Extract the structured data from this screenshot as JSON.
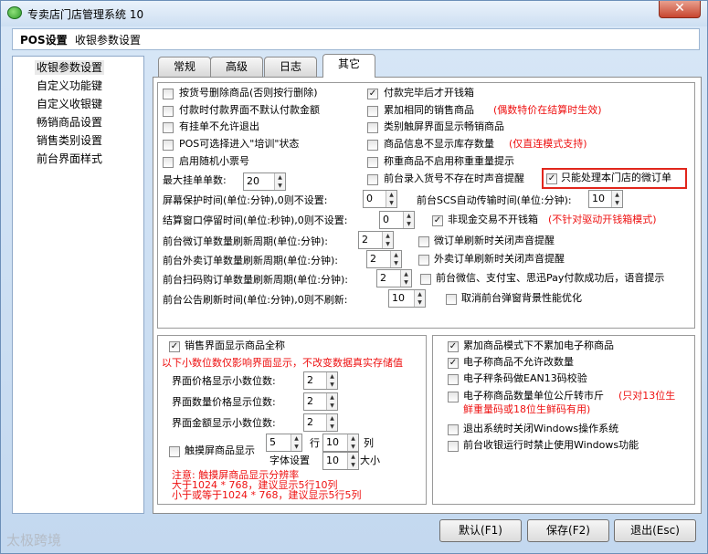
{
  "window": {
    "title": "专卖店门店管理系统 10",
    "close_label": "✕"
  },
  "menubar": {
    "items": [
      "POS设置",
      "收银参数设置"
    ]
  },
  "sidebar": {
    "items": [
      "收银参数设置",
      "自定义功能键",
      "自定义收银键",
      "畅销商品设置",
      "销售类别设置",
      "前台界面样式"
    ],
    "selected": 0
  },
  "tabs": [
    {
      "label": "常规"
    },
    {
      "label": "高级"
    },
    {
      "label": "日志"
    },
    {
      "label": "其它",
      "active": true
    }
  ],
  "top_options": {
    "left": [
      {
        "label": "按货号删除商品(否则按行删除)",
        "checked": false
      },
      {
        "label": "付款时付款界面不默认付款金额",
        "checked": false
      },
      {
        "label": "有挂单不允许退出",
        "checked": false
      },
      {
        "label": "POS可选择进入\"培训\"状态",
        "checked": false
      },
      {
        "label": "启用随机小票号",
        "checked": false
      }
    ],
    "right": [
      {
        "label": "付款完毕后才开钱箱",
        "checked": true
      },
      {
        "label": "累加相同的销售商品",
        "note": "(偶数特价在结算时生效)",
        "checked": false
      },
      {
        "label": "类别触屏界面显示畅销商品",
        "checked": false
      },
      {
        "label": "商品信息不显示库存数量",
        "note": "(仅直连模式支持)",
        "checked": false
      },
      {
        "label": "称重商品不启用称重重量提示",
        "checked": false
      },
      {
        "label": "前台录入货号不存在时声音提醒",
        "checked": false
      }
    ],
    "highlight": {
      "label": "只能处理本门店的微订单",
      "checked": true
    }
  },
  "fields": {
    "max_hold": {
      "label": "最大挂单单数:",
      "value": "20"
    },
    "screen_protect": {
      "label": "屏幕保护时间(单位:分钟),0则不设置:",
      "value": "0"
    },
    "scs_auto": {
      "label": "前台SCS自动传输时间(单位:分钟):",
      "value": "10"
    },
    "settle_stay": {
      "label": "结算窗口停留时间(单位:秒钟),0则不设置:",
      "value": "0"
    },
    "noncash": {
      "label": "非现金交易不开钱箱",
      "note": "(不针对驱动开钱箱模式)",
      "checked": true
    },
    "micro_refresh": {
      "label": "前台微订单数量刷新周期(单位:分钟):",
      "value": "2"
    },
    "micro_sound": {
      "label": "微订单刷新时关闭声音提醒",
      "checked": false
    },
    "takeout_refresh": {
      "label": "前台外卖订单数量刷新周期(单位:分钟):",
      "value": "2"
    },
    "takeout_sound": {
      "label": "外卖订单刷新时关闭声音提醒",
      "checked": false
    },
    "scan_refresh": {
      "label": "前台扫码购订单数量刷新周期(单位:分钟):",
      "value": "2"
    },
    "pay_voice": {
      "label": "前台微信、支付宝、思迅Pay付款成功后，语音提示",
      "checked": false
    },
    "notice_refresh": {
      "label": "前台公告刷新时间(单位:分钟),0则不刷新:",
      "value": "10"
    },
    "popup_opt": {
      "label": "取消前台弹窗背景性能优化",
      "checked": false
    }
  },
  "bottom_left": {
    "show_full": {
      "label": "销售界面显示商品全称",
      "checked": true
    },
    "note": "以下小数位数仅影响界面显示，不改变数据真实存储值",
    "price_dec": {
      "label": "界面价格显示小数位数:",
      "value": "2"
    },
    "qty_dec": {
      "label": "界面数量价格显示位数:",
      "value": "2"
    },
    "amt_dec": {
      "label": "界面金额显示小数位数:",
      "value": "2"
    },
    "touch": {
      "label": "触摸屏商品显示",
      "checked": false,
      "rows": "5",
      "rows_unit": "行",
      "cols": "10",
      "cols_unit": "列",
      "font_label": "字体设置",
      "font": "10",
      "font_unit": "大小"
    },
    "warn": [
      "注意: 触摸屏商品显示分辨率",
      "大于1024 * 768，建议显示5行10列",
      "小于或等于1024 * 768，建议显示5行5列"
    ]
  },
  "bottom_right": [
    {
      "label": "累加商品模式下不累加电子称商品",
      "checked": true
    },
    {
      "label": "电子称商品不允许改数量",
      "checked": true
    },
    {
      "label": "电子秤条码做EAN13码校验",
      "checked": false
    },
    {
      "label": "电子称商品数量单位公斤转市斤",
      "note": "(只对13位生",
      "note2": "鲜重量码或18位生鲜码有用)",
      "checked": false
    },
    {
      "label": "退出系统时关闭Windows操作系统",
      "checked": false
    },
    {
      "label": "前台收银运行时禁止使用Windows功能",
      "checked": false
    }
  ],
  "buttons": {
    "default": "默认(F1)",
    "save": "保存(F2)",
    "exit": "退出(Esc)"
  },
  "watermark": "太极跨境",
  "check_mark": "✓",
  "colors": {
    "red_note": "#ee1111",
    "highlight_border": "#e1261c"
  }
}
